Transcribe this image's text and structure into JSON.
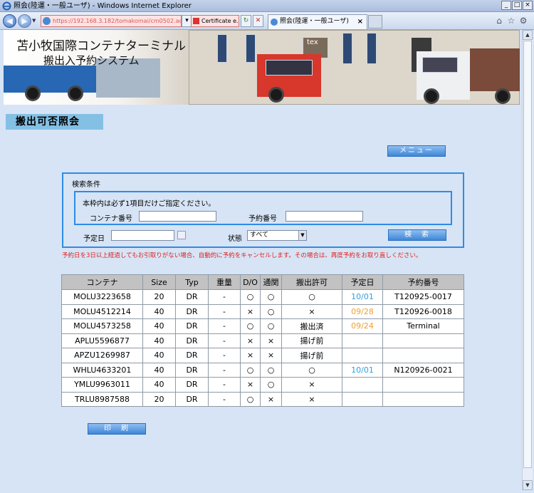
{
  "window": {
    "title": "照会(陸運・一般ユーザ) - Windows Internet Explorer",
    "address": "https://192.168.3.182/tomakomai/cm0502.action",
    "cert_label": "Certificate e...",
    "tab_label": "照会(陸運・一般ユーザ)"
  },
  "banner": {
    "line1": "苫小牧国際コンテナターミナル",
    "line2": "搬出入予約システム",
    "sign": "tex"
  },
  "page": {
    "title": "搬出可否照会",
    "menu_button": "メニュー",
    "search_button": "検　索",
    "print_button": "印　刷"
  },
  "search": {
    "section_label": "検索条件",
    "note": "本枠内は必ず1項目だけご指定ください。",
    "container_label": "コンテナ番号",
    "container_value": "",
    "reservation_label": "予約番号",
    "reservation_value": "",
    "date_label": "予定日",
    "date_value": "",
    "status_label": "状態",
    "status_selected": "すべて"
  },
  "warning": "予約日を3日以上経過してもお引取りがない場合、自動的に予約をキャンセルします。その場合は、再度予約をお取り直しください。",
  "table": {
    "headers": [
      "コンテナ",
      "Size",
      "Typ",
      "重量",
      "D/O",
      "通関",
      "搬出許可",
      "予定日",
      "予約番号"
    ],
    "rows": [
      [
        "MOLU3223658",
        "20",
        "DR",
        "-",
        "○",
        "○",
        "○",
        "10/01",
        "T120925-0017"
      ],
      [
        "MOLU4512214",
        "40",
        "DR",
        "-",
        "×",
        "○",
        "×",
        "09/28",
        "T120926-0018"
      ],
      [
        "MOLU4573258",
        "40",
        "DR",
        "-",
        "○",
        "○",
        "搬出済",
        "09/24",
        "Terminal"
      ],
      [
        "APLU5596877",
        "40",
        "DR",
        "-",
        "×",
        "×",
        "揚げ前",
        "",
        ""
      ],
      [
        "APZU1269987",
        "40",
        "DR",
        "-",
        "×",
        "×",
        "揚げ前",
        "",
        ""
      ],
      [
        "WHLU4633201",
        "40",
        "DR",
        "-",
        "○",
        "○",
        "○",
        "10/01",
        "N120926-0021"
      ],
      [
        "YMLU9963011",
        "40",
        "DR",
        "-",
        "×",
        "○",
        "×",
        "",
        ""
      ],
      [
        "TRLU8987588",
        "20",
        "DR",
        "-",
        "○",
        "×",
        "×",
        "",
        ""
      ]
    ],
    "date_colors": [
      "blue",
      "orange",
      "orange",
      "",
      "",
      "blue",
      "",
      ""
    ]
  },
  "colors": {
    "date_blue": "#2e9ee0",
    "date_orange": "#f0a030",
    "accent": "#2f8be6",
    "warning": "#e02020"
  }
}
